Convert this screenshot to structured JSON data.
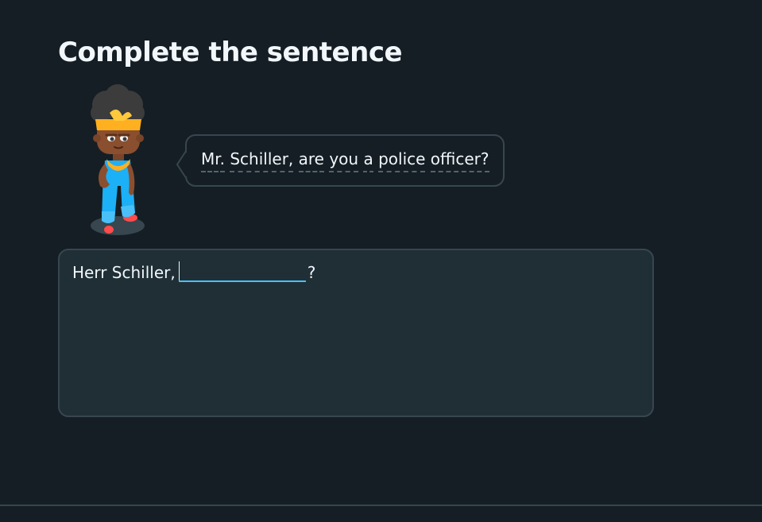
{
  "lesson": {
    "title": "Complete the sentence"
  },
  "character": {
    "icon": "character-illustration"
  },
  "speech_bubble": {
    "words": [
      "Mr.",
      "Schiller,",
      "are",
      "you",
      "a",
      "police",
      "officer?"
    ]
  },
  "answer": {
    "prefix": "Herr Schiller,",
    "blank_value": "",
    "suffix": "?"
  },
  "colors": {
    "background": "#151e24",
    "panel": "#202f36",
    "border": "#37464f",
    "accent_blue": "#49c0f8",
    "text": "#f1f7fb"
  }
}
